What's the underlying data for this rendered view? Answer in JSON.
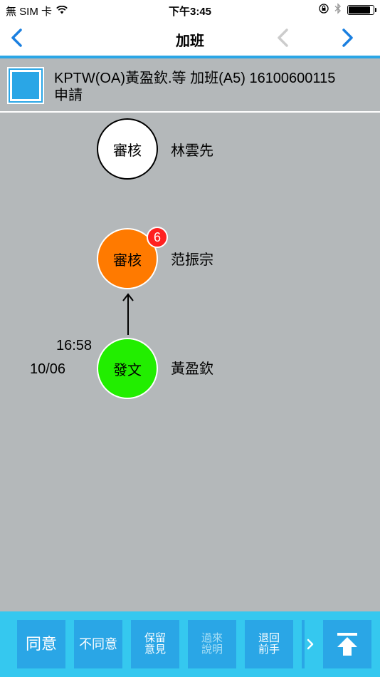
{
  "status_bar": {
    "carrier": "無 SIM 卡",
    "time": "下午3:45",
    "battery_level": 0.9
  },
  "nav": {
    "title": "加班",
    "back_icon": "chevron-left-icon",
    "prev_icon": "chevron-left-icon",
    "next_icon": "chevron-right-icon",
    "accent_color": "#2aa6e6"
  },
  "header": {
    "title": "KPTW(OA)黃盈欽.等 加班(A5) 16100600115",
    "subtitle": "申請"
  },
  "flow": {
    "nodes": [
      {
        "label": "審核",
        "person": "林雲先",
        "state": "pending",
        "color": "#ffffff"
      },
      {
        "label": "審核",
        "person": "范振宗",
        "state": "current",
        "color": "#ff7a00",
        "badge": "6"
      },
      {
        "label": "發文",
        "person": "黃盈欽",
        "state": "done",
        "color": "#22ee00",
        "time": "16:58",
        "date": "10/06"
      }
    ]
  },
  "toolbar": {
    "buttons": [
      {
        "label": "同意",
        "enabled": true
      },
      {
        "label": "不同意",
        "enabled": true
      },
      {
        "label_line1": "保留",
        "label_line2": "意見",
        "enabled": true
      },
      {
        "label_line1": "過來",
        "label_line2": "說明",
        "enabled": false
      },
      {
        "label_line1": "退回",
        "label_line2": "前手",
        "enabled": true
      }
    ],
    "more_icon": "chevron-right-icon",
    "top_icon": "arrow-to-top-icon",
    "bg_color": "#35c8ef"
  }
}
